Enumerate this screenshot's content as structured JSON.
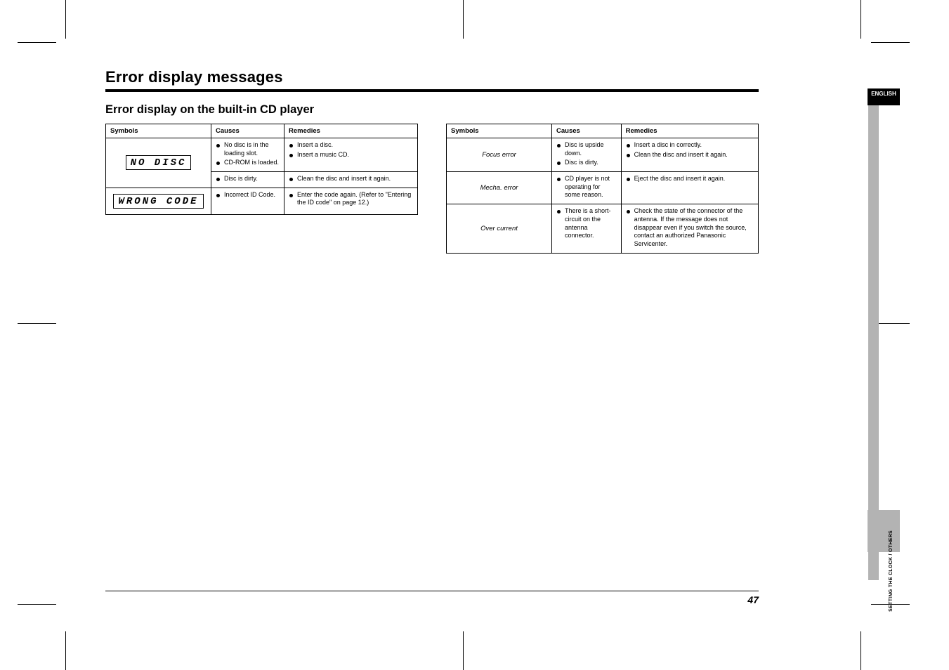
{
  "title": "Error display messages",
  "subtitle": "Error display on the built-in CD player",
  "sidebar_label_top": "ENGLISH",
  "vertical_label": "SETTING THE CLOCK / OTHERS",
  "page_number": "47",
  "left_table": {
    "headers": [
      "Symbols",
      "Causes",
      "Remedies"
    ],
    "rows": [
      {
        "symbol_lcd": "NO  DISC",
        "causes": [
          "No disc is in the loading slot.",
          "CD-ROM is loaded."
        ],
        "remedies": [
          "Insert a disc.",
          "Insert a music CD."
        ]
      },
      {
        "causes": [
          "Disc is dirty."
        ],
        "remedies": [
          "Clean the disc and insert it again."
        ]
      },
      {
        "symbol_lcd": "WRONG CODE",
        "causes": [
          "Incorrect ID Code."
        ],
        "remedies": [
          "Enter the code again. (Refer to \"Entering the ID code\" on page 12.)"
        ]
      }
    ]
  },
  "right_table": {
    "headers": [
      "Symbols",
      "Causes",
      "Remedies"
    ],
    "rows": [
      {
        "symbol_text": "Focus error",
        "causes": [
          "Disc is upside down.",
          "Disc is dirty."
        ],
        "remedies": [
          "Insert a disc in correctly.",
          "Clean the disc and insert it again."
        ]
      },
      {
        "symbol_text": "Mecha. error",
        "causes": [
          "CD player is not operating for some reason."
        ],
        "remedies": [
          "Eject the disc and insert it again."
        ]
      },
      {
        "symbol_text": "Over current",
        "causes": [
          "There is a short-circuit on the antenna connector."
        ],
        "remedies": [
          "Check the state of the connector of the antenna. If the message does not disappear even if you switch the source, contact an authorized Panasonic Servicenter."
        ]
      }
    ]
  }
}
